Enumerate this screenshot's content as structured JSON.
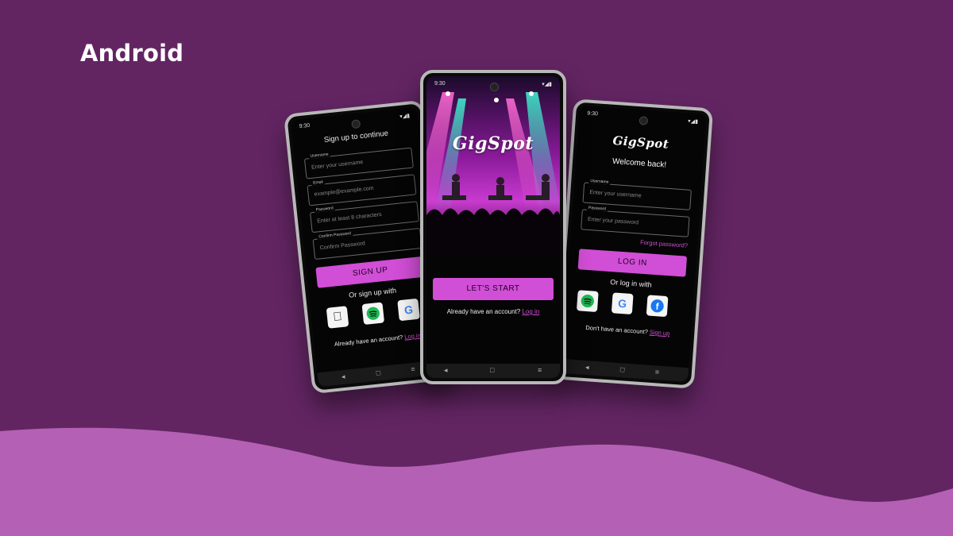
{
  "platform": {
    "title": "Android"
  },
  "brand": {
    "logo": "GigSpot",
    "accent": "#d14ed6",
    "background": "#622562",
    "wave": "#b460b4"
  },
  "status": {
    "time": "9:30",
    "icons": "▾◢▮"
  },
  "nav": {
    "back": "◂",
    "home": "□",
    "menu": "≡"
  },
  "signup": {
    "title": "Sign up to continue",
    "fields": [
      {
        "label": "Username",
        "placeholder": "Enter your username"
      },
      {
        "label": "Email",
        "placeholder": "example@example.com"
      },
      {
        "label": "Password",
        "placeholder": "Enter at least 8 characters"
      },
      {
        "label": "Confirm Password",
        "placeholder": "Confirm Password"
      }
    ],
    "button": "SIGN UP",
    "divider": "Or sign up with",
    "social": [
      "apple-icon",
      "spotify-icon",
      "google-icon"
    ],
    "footer_text": "Already have an account?",
    "footer_link": "Log in"
  },
  "welcome": {
    "button": "LET'S START",
    "footer_text": "Already have an account?",
    "footer_link": "Log in"
  },
  "login": {
    "title": "Welcome back!",
    "fields": [
      {
        "label": "Username",
        "placeholder": "Enter your username"
      },
      {
        "label": "Password",
        "placeholder": "Enter your password"
      }
    ],
    "forgot": "Forgot password?",
    "button": "LOG IN",
    "divider": "Or log in with",
    "social": [
      "spotify-icon",
      "google-icon",
      "facebook-icon"
    ],
    "footer_text": "Don't have an account?",
    "footer_link": "Sign up"
  }
}
